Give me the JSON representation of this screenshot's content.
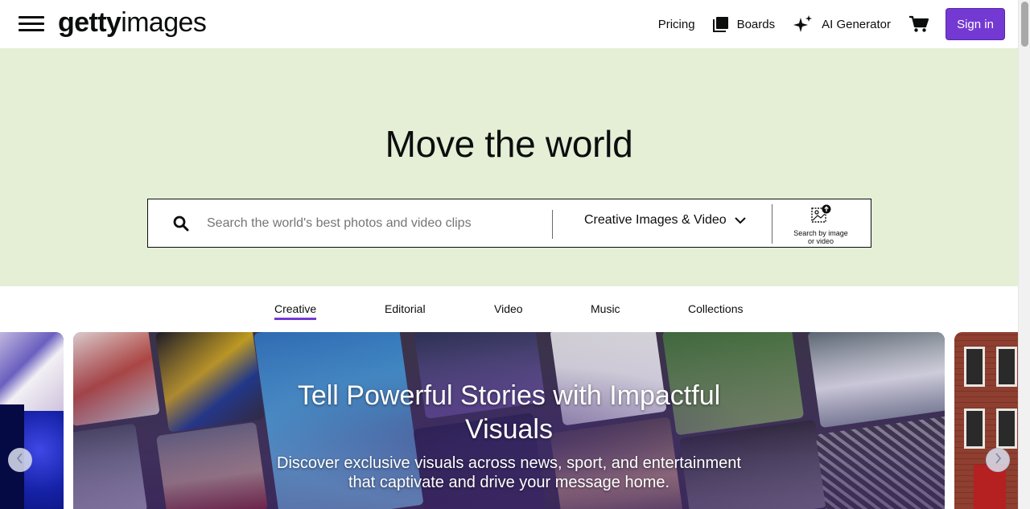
{
  "header": {
    "logo_bold": "getty",
    "logo_light": "images",
    "nav": {
      "pricing": "Pricing",
      "boards": "Boards",
      "ai_generator": "AI Generator"
    },
    "signin_label": "Sign in",
    "icons": {
      "menu": "hamburger-menu-icon",
      "boards": "boards-icon",
      "ai": "sparkle-icon",
      "cart": "cart-icon"
    }
  },
  "hero": {
    "title": "Move the world",
    "search": {
      "placeholder": "Search the world's best photos and video clips",
      "type_selected": "Creative Images & Video",
      "image_search_line1": "Search by image",
      "image_search_line2": "or video"
    }
  },
  "tabs": [
    {
      "label": "Creative",
      "active": true
    },
    {
      "label": "Editorial",
      "active": false
    },
    {
      "label": "Video",
      "active": false
    },
    {
      "label": "Music",
      "active": false
    },
    {
      "label": "Collections",
      "active": false
    }
  ],
  "carousel": {
    "title": "Tell Powerful Stories with Impactful Visuals",
    "subtitle": "Discover exclusive visuals across news, sport, and entertainment that captivate and drive your message home."
  },
  "colors": {
    "brand_purple": "#7439d2",
    "hero_bg": "#e4efd6"
  }
}
